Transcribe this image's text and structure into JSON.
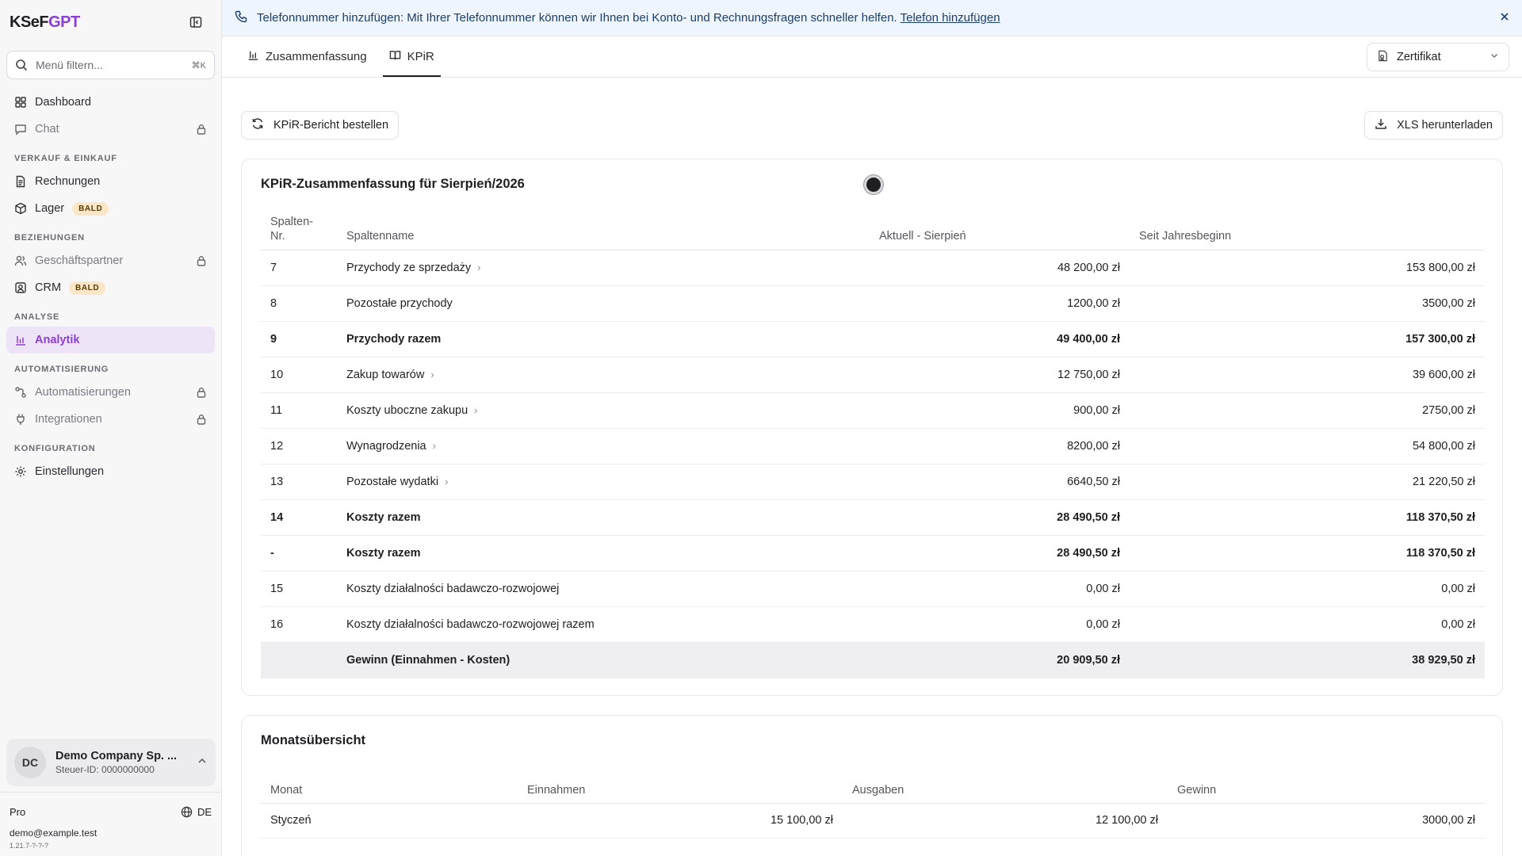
{
  "brand": {
    "part1": "KSeF",
    "part2": "GPT"
  },
  "sidebar": {
    "search_placeholder": "Menü filtern...",
    "search_shortcut": "⌘K",
    "top_items": [
      {
        "label": "Dashboard",
        "icon": "dashboard-icon"
      },
      {
        "label": "Chat",
        "icon": "chat-icon",
        "locked": true
      }
    ],
    "sections": [
      {
        "heading": "VERKAUF & EINKAUF",
        "items": [
          {
            "label": "Rechnungen",
            "icon": "invoice-icon"
          },
          {
            "label": "Lager",
            "icon": "box-icon",
            "badge": "BALD"
          }
        ]
      },
      {
        "heading": "BEZIEHUNGEN",
        "items": [
          {
            "label": "Geschäftspartner",
            "icon": "users-icon",
            "locked": true
          },
          {
            "label": "CRM",
            "icon": "contact-icon",
            "badge": "BALD"
          }
        ]
      },
      {
        "heading": "ANALYSE",
        "items": [
          {
            "label": "Analytik",
            "icon": "bar-chart-icon",
            "active": true
          }
        ]
      },
      {
        "heading": "AUTOMATISIERUNG",
        "items": [
          {
            "label": "Automatisierungen",
            "icon": "workflow-icon",
            "locked": true
          },
          {
            "label": "Integrationen",
            "icon": "plug-icon",
            "locked": true
          }
        ]
      },
      {
        "heading": "KONFIGURATION",
        "items": [
          {
            "label": "Einstellungen",
            "icon": "gear-icon"
          }
        ]
      }
    ],
    "company": {
      "initials": "DC",
      "name": "Demo Company Sp. ...",
      "tax_id": "Steuer-ID: 0000000000"
    },
    "plan": "Pro",
    "language": "DE",
    "email": "demo@example.test",
    "version": "1.21.7-?-?-?"
  },
  "banner": {
    "text": "Telefonnummer hinzufügen: Mit Ihrer Telefonnummer können wir Ihnen bei Konto- und Rechnungsfragen schneller helfen.",
    "link": "Telefon hinzufügen"
  },
  "tabs": [
    {
      "label": "Zusammenfassung",
      "icon": "bar-chart-icon",
      "active": false
    },
    {
      "label": "KPiR",
      "icon": "book-icon",
      "active": true
    }
  ],
  "certificate_select": "Zertifikat",
  "actions": {
    "order_report": "KPiR-Bericht bestellen",
    "download_xls": "XLS herunterladen"
  },
  "kpir": {
    "title": "KPiR-Zusammenfassung für Sierpień/2026",
    "headers": {
      "nr": "Spalten-Nr.",
      "name": "Spaltenname",
      "current": "Aktuell - Sierpień",
      "ytd": "Seit Jahresbeginn"
    },
    "rows": [
      {
        "nr": "7",
        "name": "Przychody ze sprzedaży",
        "current": "48 200,00 zł",
        "ytd": "153 800,00 zł",
        "expandable": true,
        "bold": false
      },
      {
        "nr": "8",
        "name": "Pozostałe przychody",
        "current": "1200,00 zł",
        "ytd": "3500,00 zł",
        "expandable": false,
        "bold": false
      },
      {
        "nr": "9",
        "name": "Przychody razem",
        "current": "49 400,00 zł",
        "ytd": "157 300,00 zł",
        "expandable": false,
        "bold": true
      },
      {
        "nr": "10",
        "name": "Zakup towarów",
        "current": "12 750,00 zł",
        "ytd": "39 600,00 zł",
        "expandable": true,
        "bold": false
      },
      {
        "nr": "11",
        "name": "Koszty uboczne zakupu",
        "current": "900,00 zł",
        "ytd": "2750,00 zł",
        "expandable": true,
        "bold": false
      },
      {
        "nr": "12",
        "name": "Wynagrodzenia",
        "current": "8200,00 zł",
        "ytd": "54 800,00 zł",
        "expandable": true,
        "bold": false
      },
      {
        "nr": "13",
        "name": "Pozostałe wydatki",
        "current": "6640,50 zł",
        "ytd": "21 220,50 zł",
        "expandable": true,
        "bold": false
      },
      {
        "nr": "14",
        "name": "Koszty razem",
        "current": "28 490,50 zł",
        "ytd": "118 370,50 zł",
        "expandable": false,
        "bold": true
      },
      {
        "nr": "-",
        "name": "Koszty razem",
        "current": "28 490,50 zł",
        "ytd": "118 370,50 zł",
        "expandable": false,
        "bold": true
      },
      {
        "nr": "15",
        "name": "Koszty działalności badawczo-rozwojowej",
        "current": "0,00 zł",
        "ytd": "0,00 zł",
        "expandable": false,
        "bold": false
      },
      {
        "nr": "16",
        "name": "Koszty działalności badawczo-rozwojowej razem",
        "current": "0,00 zł",
        "ytd": "0,00 zł",
        "expandable": false,
        "bold": false
      }
    ],
    "total": {
      "nr": "",
      "name": "Gewinn (Einnahmen - Kosten)",
      "current": "20 909,50 zł",
      "ytd": "38 929,50 zł"
    }
  },
  "monthly": {
    "title": "Monatsübersicht",
    "headers": {
      "month": "Monat",
      "income": "Einnahmen",
      "expenses": "Ausgaben",
      "profit": "Gewinn"
    },
    "rows": [
      {
        "month": "Styczeń",
        "income": "15 100,00 zł",
        "expenses": "12 100,00 zł",
        "profit": "3000,00 zł"
      }
    ]
  }
}
